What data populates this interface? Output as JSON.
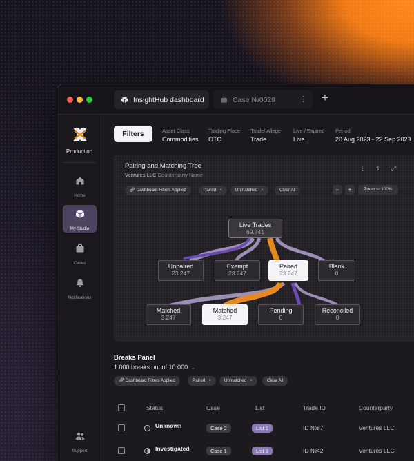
{
  "tabs": [
    {
      "label": "InsightHub dashboard",
      "active": true
    },
    {
      "label": "Case №0029",
      "active": false
    }
  ],
  "sidebar": {
    "workspace": "Production",
    "items": [
      {
        "label": "Home",
        "icon": "home-icon"
      },
      {
        "label": "My Studio",
        "icon": "cube-icon",
        "active": true
      },
      {
        "label": "Cases",
        "icon": "briefcase-icon"
      },
      {
        "label": "Notifications",
        "icon": "bell-icon"
      },
      {
        "label": "Support",
        "icon": "people-icon"
      }
    ]
  },
  "filters": {
    "button": "Filters",
    "items": [
      {
        "label": "Asset Class",
        "value": "Commodities"
      },
      {
        "label": "Trading Place",
        "value": "OTC"
      },
      {
        "label": "Trade/ Allege",
        "value": "Trade"
      },
      {
        "label": "Live / Expired",
        "value": "Live"
      },
      {
        "label": "Period",
        "value": "20 Aug 2023 - 22 Sep 2023"
      }
    ]
  },
  "tree": {
    "title": "Pairing and Matching Tree",
    "subtitle_main": "Ventures LLC",
    "subtitle_light": "Counterparty Name",
    "chips": {
      "dashboard": "Dashboard Filters Applied",
      "paired": "Paired",
      "unmatched": "Unmatched",
      "clear": "Clear All"
    },
    "zoom": {
      "minus": "−",
      "plus": "+",
      "reset": "Zoom to 100%"
    },
    "nodes": {
      "live": {
        "label": "Live Trades",
        "value": "69.741"
      },
      "unpaired": {
        "label": "Unpaired",
        "value": "23.247"
      },
      "exempt": {
        "label": "Exempt",
        "value": "23.247"
      },
      "paired": {
        "label": "Paired",
        "value": "23.247"
      },
      "blank": {
        "label": "Blank",
        "value": "0"
      },
      "matched1": {
        "label": "Matched",
        "value": "3.247"
      },
      "matched2": {
        "label": "Matched",
        "value": "3.247"
      },
      "pending": {
        "label": "Pending",
        "value": "0"
      },
      "reconciled": {
        "label": "Reconciled",
        "value": "0"
      }
    },
    "colors": {
      "orange": "#e8891c",
      "purple": "#6d4bb3",
      "lavender": "#a89bc7"
    }
  },
  "breaks": {
    "title": "Breaks Panel",
    "count": "1.000 breaks out of 10.000",
    "chips": {
      "dashboard": "Dashboard Filters Applied",
      "paired": "Paired",
      "unmatched": "Unmatched",
      "clear": "Clear All"
    },
    "columns": [
      "Status",
      "Case",
      "List",
      "Trade ID",
      "Counterparty"
    ],
    "rows": [
      {
        "status": "Unknown",
        "case": "Case 2",
        "list": "List 1",
        "trade_id": "ID №87",
        "counterparty": "Ventures LLC"
      },
      {
        "status": "Investigated",
        "case": "Case 1",
        "list": "List 3",
        "trade_id": "ID №42",
        "counterparty": "Ventures LLC"
      }
    ]
  }
}
